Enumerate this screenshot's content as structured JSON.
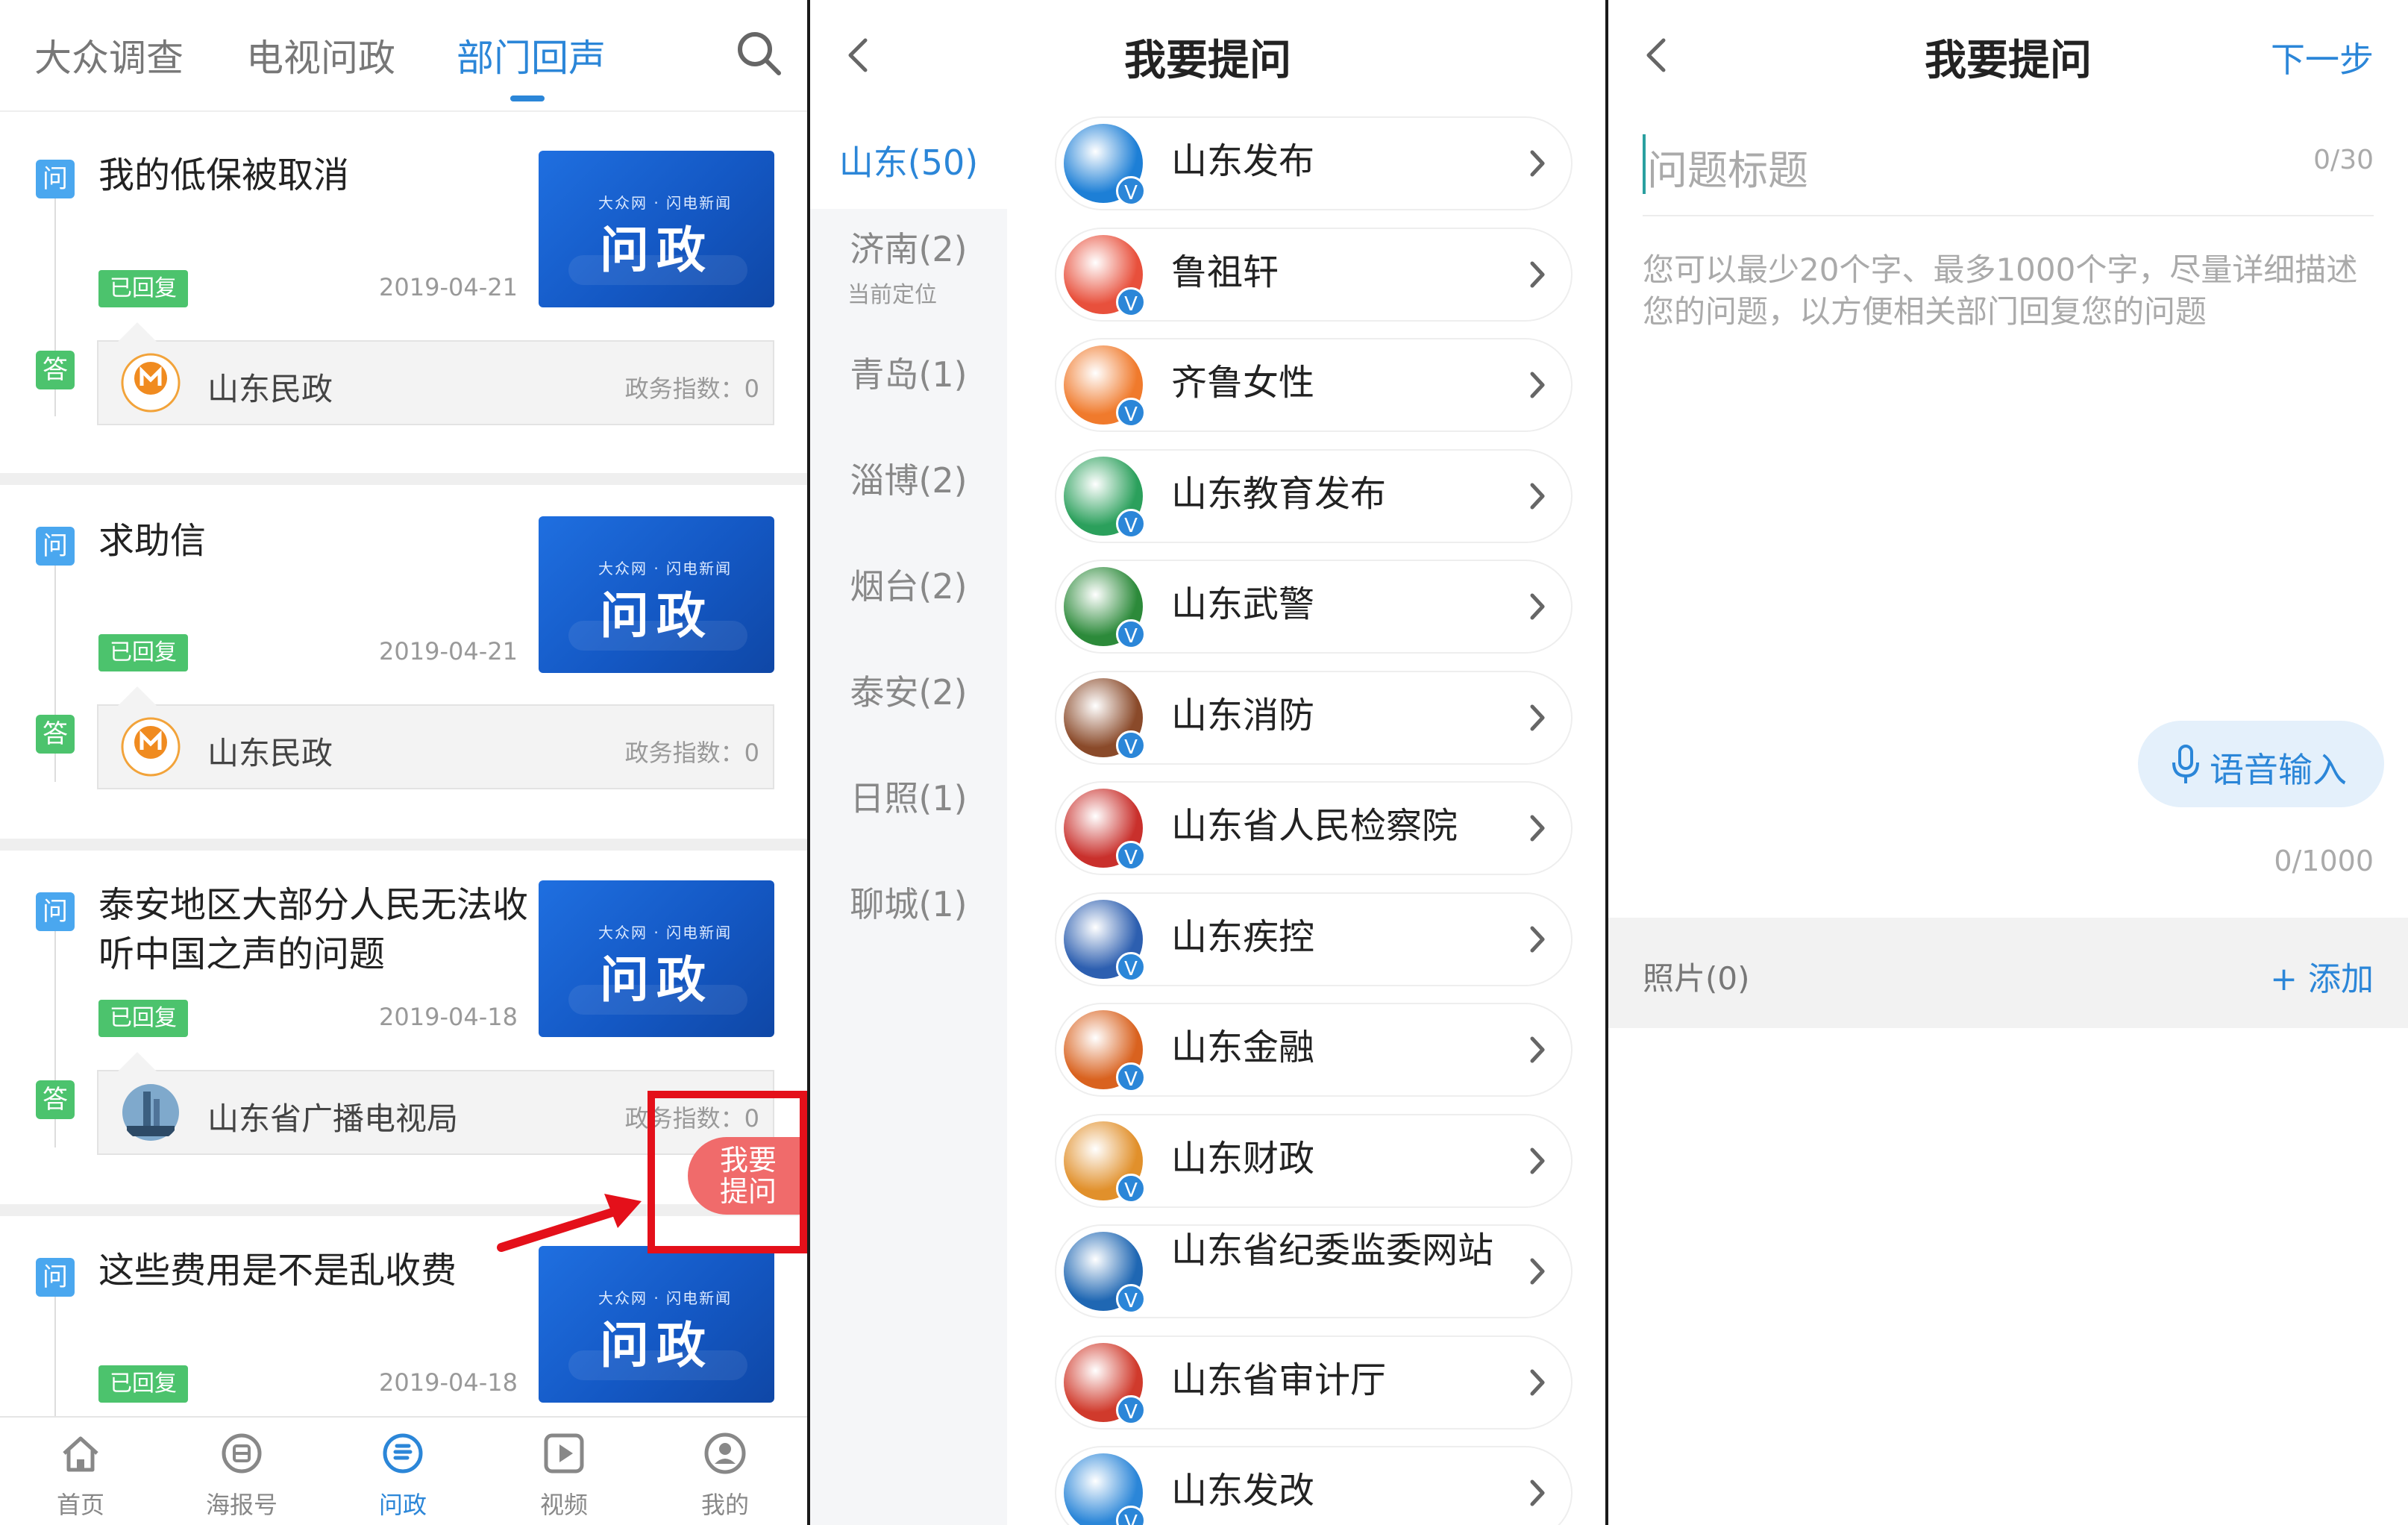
{
  "panel1": {
    "tabs": [
      "大众调查",
      "电视问政",
      "部门回声"
    ],
    "active_tab": "部门回声",
    "search_icon": "search-icon",
    "accent_color": "#2b86d8",
    "q_tag": "问",
    "a_tag": "答",
    "replied_badge": "已回复",
    "thumb_brand": "大众网 · 闪电新闻",
    "thumb_label": "问政",
    "cards": [
      {
        "question": "我的低保被取消",
        "date": "2019-04-21",
        "answer_org": "山东民政",
        "index_text": "政务指数：0"
      },
      {
        "question": "求助信",
        "date": "2019-04-21",
        "answer_org": "山东民政",
        "index_text": "政务指数：0"
      },
      {
        "question": "泰安地区大部分人民无法收听中国之声的问题",
        "date": "2019-04-18",
        "answer_org": "山东省广播电视局",
        "index_text": "政务指数：0"
      },
      {
        "question": "这些费用是不是乱收费",
        "date": "2019-04-18"
      }
    ],
    "fab_label_line1": "我要",
    "fab_label_line2": "提问",
    "bottom_nav": [
      {
        "label": "首页",
        "icon": "home-icon"
      },
      {
        "label": "海报号",
        "icon": "poster-icon"
      },
      {
        "label": "问政",
        "icon": "ask-icon"
      },
      {
        "label": "视频",
        "icon": "video-icon"
      },
      {
        "label": "我的",
        "icon": "profile-icon"
      }
    ],
    "active_nav": "问政"
  },
  "panel2": {
    "title": "我要提问",
    "cities": [
      {
        "label": "山东(50)",
        "sub": ""
      },
      {
        "label": "济南(2)",
        "sub": "当前定位"
      },
      {
        "label": "青岛(1)",
        "sub": ""
      },
      {
        "label": "淄博(2)",
        "sub": ""
      },
      {
        "label": "烟台(2)",
        "sub": ""
      },
      {
        "label": "泰安(2)",
        "sub": ""
      },
      {
        "label": "日照(1)",
        "sub": ""
      },
      {
        "label": "聊城(1)",
        "sub": ""
      }
    ],
    "active_city": "山东(50)",
    "verified_mark": "V",
    "departments": [
      {
        "name": "山东发布",
        "color": "#1d7fd6"
      },
      {
        "name": "鲁祖轩",
        "color": "#e8503c"
      },
      {
        "name": "齐鲁女性",
        "color": "#f07a2c"
      },
      {
        "name": "山东教育发布",
        "color": "#2ba05c"
      },
      {
        "name": "山东武警",
        "color": "#2c8a3a"
      },
      {
        "name": "山东消防",
        "color": "#8a4a2a"
      },
      {
        "name": "山东省人民检察院",
        "color": "#c9302c"
      },
      {
        "name": "山东疾控",
        "color": "#2d5fb0"
      },
      {
        "name": "山东金融",
        "color": "#d9621f"
      },
      {
        "name": "山东财政",
        "color": "#e1902b"
      },
      {
        "name": "山东省纪委监委网站",
        "color": "#1f67b3"
      },
      {
        "name": "山东省审计厅",
        "color": "#d03a2c"
      },
      {
        "name": "山东发改",
        "color": "#2b86d8"
      }
    ]
  },
  "panel3": {
    "title": "我要提问",
    "next_label": "下一步",
    "title_placeholder": "问题标题",
    "title_count": "0/30",
    "body_placeholder": "您可以最少20个字、最多1000个字，尽量详细描述您的问题，以方便相关部门回复您的问题",
    "voice_label": "语音输入",
    "body_count": "0/1000",
    "photo_label": "照片(0)",
    "photo_add": "+ 添加"
  }
}
